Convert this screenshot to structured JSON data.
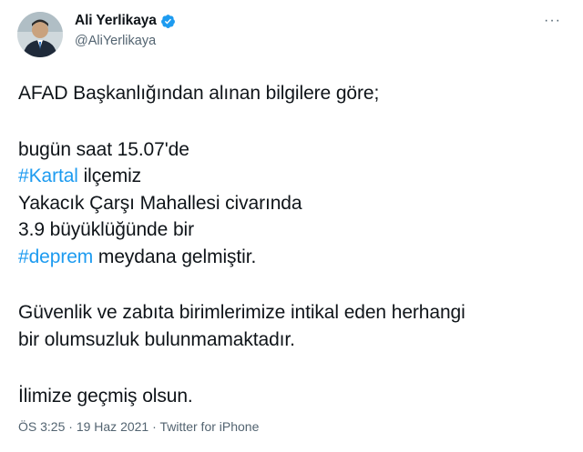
{
  "author": {
    "display_name": "Ali Yerlikaya",
    "handle": "@AliYerlikaya",
    "verified": true
  },
  "more_menu": "···",
  "tweet": {
    "line1": "AFAD Başkanlığından alınan bilgilere göre;",
    "line2": "bugün saat 15.07'de",
    "hashtag1": "#Kartal",
    "line3_rest": " ilçemiz",
    "line4": "Yakacık Çarşı Mahallesi civarında",
    "line5": "3.9 büyüklüğünde bir",
    "hashtag2": "#deprem",
    "line6_rest": " meydana gelmiştir.",
    "line7": "Güvenlik ve zabıta birimlerimize intikal eden herhangi",
    "line8": "bir olumsuzluk bulunmamaktadır.",
    "line9": "İlimize geçmiş olsun."
  },
  "meta": {
    "time": "ÖS 3:25",
    "separator": " · ",
    "date": "19 Haz 2021",
    "source": "Twitter for iPhone"
  },
  "colors": {
    "link": "#1d9bf0",
    "text": "#0f1419",
    "secondary": "#536471"
  }
}
